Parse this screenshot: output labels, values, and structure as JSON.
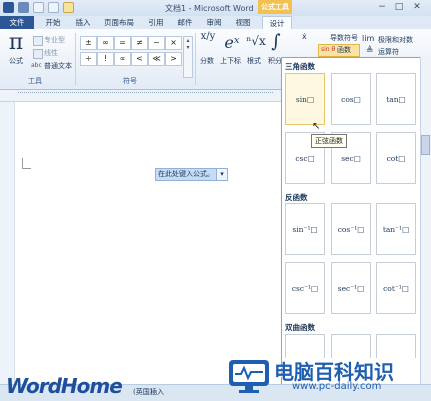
{
  "window": {
    "title": "文档1 - Microsoft Word",
    "context_tab_header": "公式工具",
    "controls": [
      "−",
      "□",
      "✕"
    ]
  },
  "tabs": [
    {
      "label": "文件"
    },
    {
      "label": "开始"
    },
    {
      "label": "插入"
    },
    {
      "label": "页面布局"
    },
    {
      "label": "引用"
    },
    {
      "label": "邮件"
    },
    {
      "label": "审阅"
    },
    {
      "label": "视图"
    },
    {
      "label": "设计"
    }
  ],
  "ribbon": {
    "tools_group": {
      "label": "工具",
      "equation_label": "公式",
      "professional": "专业型",
      "linear": "线性",
      "normal_text": "普通文本",
      "abc": "abc"
    },
    "symbols_group": {
      "label": "符号",
      "row1": [
        "±",
        "∞",
        "=",
        "≠",
        "~",
        "×"
      ],
      "row2": [
        "÷",
        "!",
        "∝",
        "<",
        "≪",
        ">"
      ]
    },
    "structures": {
      "fraction": "分数",
      "script": "上下标",
      "radical": "根式",
      "integral": "积分",
      "fraction_glyph": "x/y",
      "script_glyph": "eˣ",
      "radical_glyph": "ⁿ√x",
      "integral_glyph": "∫",
      "accent": "导数符号",
      "function": "函数",
      "function_badge": "sin θ",
      "limit": "极限和对数",
      "operator": "运算符"
    }
  },
  "document": {
    "equation_placeholder": "在此处键入公式。",
    "dropdown_glyph": "▾"
  },
  "panel": {
    "sections": [
      {
        "title": "三角函数",
        "items": [
          "sin□",
          "cos□",
          "tan□",
          "csc□",
          "sec□",
          "cot□"
        ]
      },
      {
        "title": "反函数",
        "items": [
          "sin⁻¹□",
          "cos⁻¹□",
          "tan⁻¹□",
          "csc⁻¹□",
          "sec⁻¹□",
          "cot⁻¹□"
        ]
      },
      {
        "title": "双曲函数",
        "items": []
      }
    ],
    "tooltip": "正弦函数"
  },
  "statusbar": {
    "insert_mode": "插入",
    "fragment": "(英国)"
  },
  "watermark": {
    "left": "WordHome",
    "right_cn": "电脑百科知识",
    "right_url": "www.pc-daily.com"
  }
}
